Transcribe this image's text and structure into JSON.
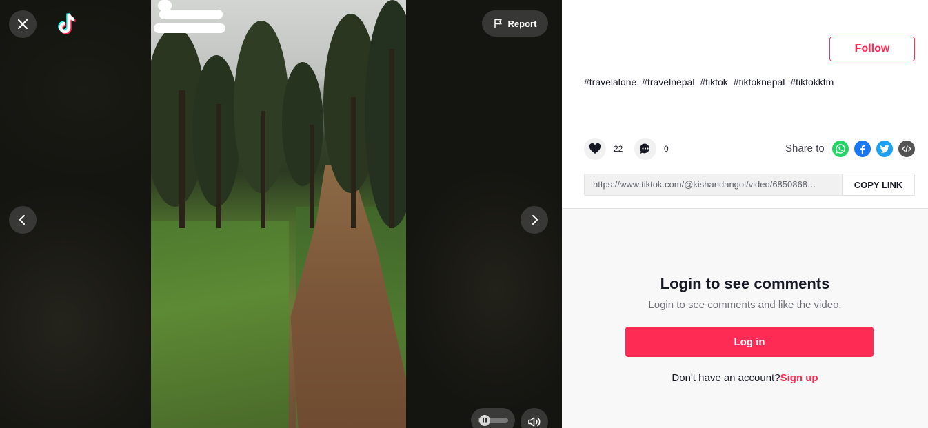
{
  "video": {
    "report_label": "Report"
  },
  "details": {
    "follow_label": "Follow",
    "hashtags": [
      "#travelalone",
      "#travelnepal",
      "#tiktok",
      "#tiktoknepal",
      "#tiktokktm"
    ],
    "likes": "22",
    "comments": "0",
    "share_label": "Share to",
    "share_targets": [
      "whatsapp",
      "facebook",
      "twitter",
      "embed"
    ],
    "link": "https://www.tiktok.com/@kishandangol/video/6850868…",
    "copy_link_label": "COPY LINK"
  },
  "comments_panel": {
    "title": "Login to see comments",
    "subtitle": "Login to see comments and like the video.",
    "login_label": "Log in",
    "no_account_text": "Don't have an account?",
    "signup_label": "Sign up"
  },
  "colors": {
    "brand": "#fe2c55",
    "whatsapp": "#25d366",
    "facebook": "#1877f2",
    "twitter": "#1da1f2",
    "embed": "#545454"
  }
}
